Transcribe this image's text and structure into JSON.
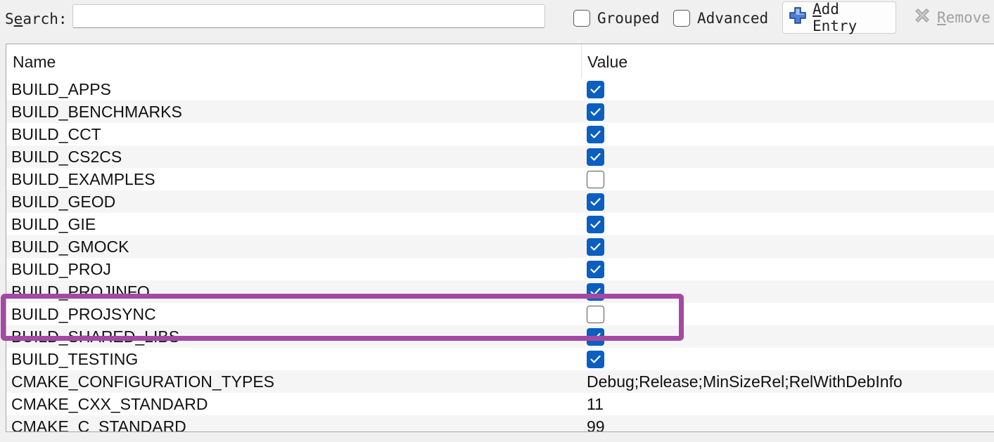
{
  "toolbar": {
    "search_label_pre": "S",
    "search_label_mnemonic": "e",
    "search_label_post": "arch:",
    "search_value": "",
    "grouped_label": "Grouped",
    "grouped_checked": false,
    "advanced_label": "Advanced",
    "advanced_checked": false,
    "add_mnemonic": "A",
    "add_label_rest": "dd Entry",
    "remove_mnemonic": "R",
    "remove_label_rest": "emove",
    "add_icon": "plus-icon",
    "remove_icon": "x-icon"
  },
  "table": {
    "columns": [
      "Name",
      "Value"
    ],
    "rows": [
      {
        "name": "BUILD_APPS",
        "type": "bool",
        "checked": true
      },
      {
        "name": "BUILD_BENCHMARKS",
        "type": "bool",
        "checked": true
      },
      {
        "name": "BUILD_CCT",
        "type": "bool",
        "checked": true
      },
      {
        "name": "BUILD_CS2CS",
        "type": "bool",
        "checked": true
      },
      {
        "name": "BUILD_EXAMPLES",
        "type": "bool",
        "checked": false
      },
      {
        "name": "BUILD_GEOD",
        "type": "bool",
        "checked": true
      },
      {
        "name": "BUILD_GIE",
        "type": "bool",
        "checked": true
      },
      {
        "name": "BUILD_GMOCK",
        "type": "bool",
        "checked": true
      },
      {
        "name": "BUILD_PROJ",
        "type": "bool",
        "checked": true
      },
      {
        "name": "BUILD_PROJINFO",
        "type": "bool",
        "checked": true
      },
      {
        "name": "BUILD_PROJSYNC",
        "type": "bool",
        "checked": false
      },
      {
        "name": "BUILD_SHARED_LIBS",
        "type": "bool",
        "checked": true
      },
      {
        "name": "BUILD_TESTING",
        "type": "bool",
        "checked": true
      },
      {
        "name": "CMAKE_CONFIGURATION_TYPES",
        "type": "text",
        "value": "Debug;Release;MinSizeRel;RelWithDebInfo"
      },
      {
        "name": "CMAKE_CXX_STANDARD",
        "type": "text",
        "value": "11"
      },
      {
        "name": "CMAKE_C_STANDARD",
        "type": "text",
        "value": "99"
      }
    ]
  },
  "colors": {
    "check_on": "#0a5fc0",
    "highlight": "#a349a4",
    "row_alt": "#f5f5f5"
  }
}
